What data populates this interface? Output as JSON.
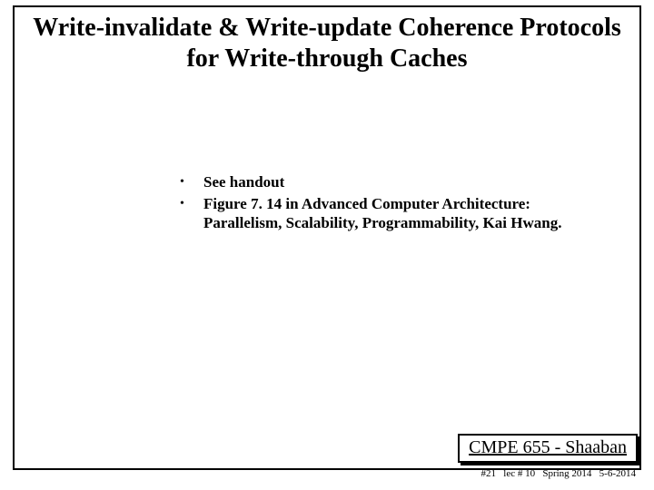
{
  "title": "Write-invalidate & Write-update Coherence Protocols for Write-through Caches",
  "bullets": [
    "See handout",
    "Figure 7. 14  in  Advanced Computer Architecture: Parallelism, Scalability, Programmability, Kai Hwang."
  ],
  "footer_course": "CMPE 655 - Shaaban",
  "footer_meta": "#21   lec # 10   Spring 2014   5-6-2014"
}
